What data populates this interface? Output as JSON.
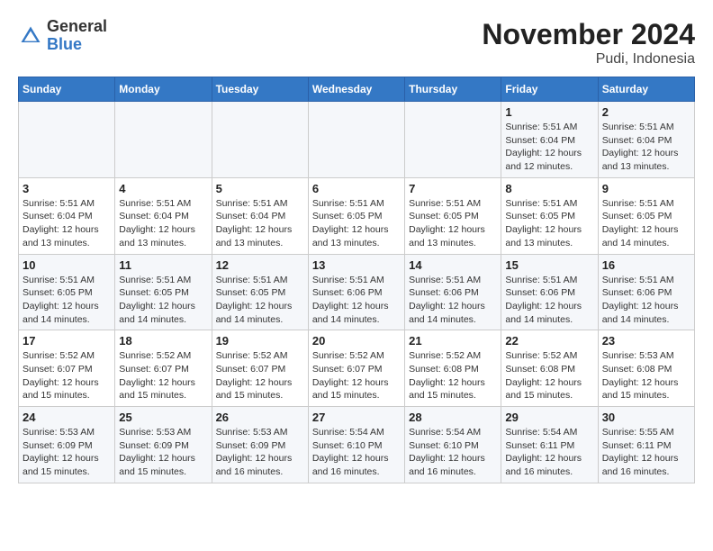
{
  "header": {
    "logo": {
      "general": "General",
      "blue": "Blue"
    },
    "title": "November 2024",
    "location": "Pudi, Indonesia"
  },
  "calendar": {
    "days_of_week": [
      "Sunday",
      "Monday",
      "Tuesday",
      "Wednesday",
      "Thursday",
      "Friday",
      "Saturday"
    ],
    "weeks": [
      [
        {
          "day": "",
          "info": ""
        },
        {
          "day": "",
          "info": ""
        },
        {
          "day": "",
          "info": ""
        },
        {
          "day": "",
          "info": ""
        },
        {
          "day": "",
          "info": ""
        },
        {
          "day": "1",
          "info": "Sunrise: 5:51 AM\nSunset: 6:04 PM\nDaylight: 12 hours and 12 minutes."
        },
        {
          "day": "2",
          "info": "Sunrise: 5:51 AM\nSunset: 6:04 PM\nDaylight: 12 hours and 13 minutes."
        }
      ],
      [
        {
          "day": "3",
          "info": "Sunrise: 5:51 AM\nSunset: 6:04 PM\nDaylight: 12 hours and 13 minutes."
        },
        {
          "day": "4",
          "info": "Sunrise: 5:51 AM\nSunset: 6:04 PM\nDaylight: 12 hours and 13 minutes."
        },
        {
          "day": "5",
          "info": "Sunrise: 5:51 AM\nSunset: 6:04 PM\nDaylight: 12 hours and 13 minutes."
        },
        {
          "day": "6",
          "info": "Sunrise: 5:51 AM\nSunset: 6:05 PM\nDaylight: 12 hours and 13 minutes."
        },
        {
          "day": "7",
          "info": "Sunrise: 5:51 AM\nSunset: 6:05 PM\nDaylight: 12 hours and 13 minutes."
        },
        {
          "day": "8",
          "info": "Sunrise: 5:51 AM\nSunset: 6:05 PM\nDaylight: 12 hours and 13 minutes."
        },
        {
          "day": "9",
          "info": "Sunrise: 5:51 AM\nSunset: 6:05 PM\nDaylight: 12 hours and 14 minutes."
        }
      ],
      [
        {
          "day": "10",
          "info": "Sunrise: 5:51 AM\nSunset: 6:05 PM\nDaylight: 12 hours and 14 minutes."
        },
        {
          "day": "11",
          "info": "Sunrise: 5:51 AM\nSunset: 6:05 PM\nDaylight: 12 hours and 14 minutes."
        },
        {
          "day": "12",
          "info": "Sunrise: 5:51 AM\nSunset: 6:05 PM\nDaylight: 12 hours and 14 minutes."
        },
        {
          "day": "13",
          "info": "Sunrise: 5:51 AM\nSunset: 6:06 PM\nDaylight: 12 hours and 14 minutes."
        },
        {
          "day": "14",
          "info": "Sunrise: 5:51 AM\nSunset: 6:06 PM\nDaylight: 12 hours and 14 minutes."
        },
        {
          "day": "15",
          "info": "Sunrise: 5:51 AM\nSunset: 6:06 PM\nDaylight: 12 hours and 14 minutes."
        },
        {
          "day": "16",
          "info": "Sunrise: 5:51 AM\nSunset: 6:06 PM\nDaylight: 12 hours and 14 minutes."
        }
      ],
      [
        {
          "day": "17",
          "info": "Sunrise: 5:52 AM\nSunset: 6:07 PM\nDaylight: 12 hours and 15 minutes."
        },
        {
          "day": "18",
          "info": "Sunrise: 5:52 AM\nSunset: 6:07 PM\nDaylight: 12 hours and 15 minutes."
        },
        {
          "day": "19",
          "info": "Sunrise: 5:52 AM\nSunset: 6:07 PM\nDaylight: 12 hours and 15 minutes."
        },
        {
          "day": "20",
          "info": "Sunrise: 5:52 AM\nSunset: 6:07 PM\nDaylight: 12 hours and 15 minutes."
        },
        {
          "day": "21",
          "info": "Sunrise: 5:52 AM\nSunset: 6:08 PM\nDaylight: 12 hours and 15 minutes."
        },
        {
          "day": "22",
          "info": "Sunrise: 5:52 AM\nSunset: 6:08 PM\nDaylight: 12 hours and 15 minutes."
        },
        {
          "day": "23",
          "info": "Sunrise: 5:53 AM\nSunset: 6:08 PM\nDaylight: 12 hours and 15 minutes."
        }
      ],
      [
        {
          "day": "24",
          "info": "Sunrise: 5:53 AM\nSunset: 6:09 PM\nDaylight: 12 hours and 15 minutes."
        },
        {
          "day": "25",
          "info": "Sunrise: 5:53 AM\nSunset: 6:09 PM\nDaylight: 12 hours and 15 minutes."
        },
        {
          "day": "26",
          "info": "Sunrise: 5:53 AM\nSunset: 6:09 PM\nDaylight: 12 hours and 16 minutes."
        },
        {
          "day": "27",
          "info": "Sunrise: 5:54 AM\nSunset: 6:10 PM\nDaylight: 12 hours and 16 minutes."
        },
        {
          "day": "28",
          "info": "Sunrise: 5:54 AM\nSunset: 6:10 PM\nDaylight: 12 hours and 16 minutes."
        },
        {
          "day": "29",
          "info": "Sunrise: 5:54 AM\nSunset: 6:11 PM\nDaylight: 12 hours and 16 minutes."
        },
        {
          "day": "30",
          "info": "Sunrise: 5:55 AM\nSunset: 6:11 PM\nDaylight: 12 hours and 16 minutes."
        }
      ]
    ]
  }
}
